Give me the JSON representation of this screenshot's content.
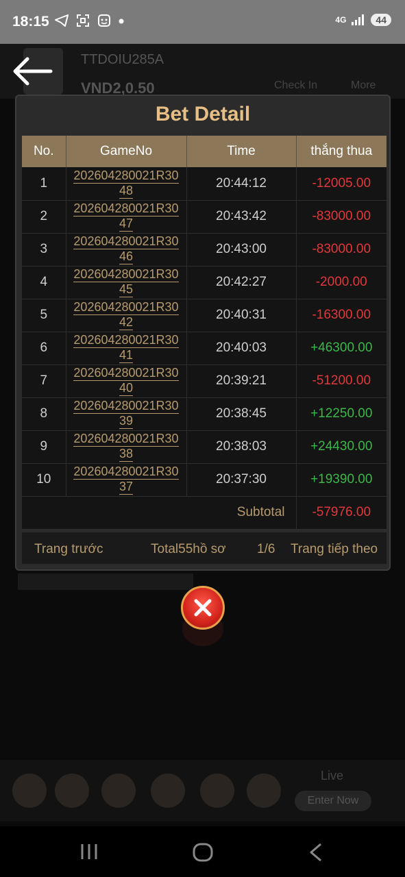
{
  "status_bar": {
    "time": "18:15",
    "network": "4G",
    "battery": "44",
    "icons": [
      "telegram-icon",
      "scan-icon",
      "bot-icon",
      "dot-icon",
      "signal-icon"
    ]
  },
  "background": {
    "username": "TTDOIU285A",
    "balance": "VND2,0.50",
    "menu_items": [
      "Check In",
      "More"
    ],
    "live_label": "Live",
    "enter_now_label": "Enter Now"
  },
  "modal": {
    "title": "Bet Detail",
    "columns": [
      "No.",
      "GameNo",
      "Time",
      "thắng thua"
    ],
    "rows": [
      {
        "no": "1",
        "game_line1": "202604280021R30",
        "game_line2": "48",
        "time": "20:44:12",
        "result": "-12005.00"
      },
      {
        "no": "2",
        "game_line1": "202604280021R30",
        "game_line2": "47",
        "time": "20:43:42",
        "result": "-83000.00"
      },
      {
        "no": "3",
        "game_line1": "202604280021R30",
        "game_line2": "46",
        "time": "20:43:00",
        "result": "-83000.00"
      },
      {
        "no": "4",
        "game_line1": "202604280021R30",
        "game_line2": "45",
        "time": "20:42:27",
        "result": "-2000.00"
      },
      {
        "no": "5",
        "game_line1": "202604280021R30",
        "game_line2": "42",
        "time": "20:40:31",
        "result": "-16300.00"
      },
      {
        "no": "6",
        "game_line1": "202604280021R30",
        "game_line2": "41",
        "time": "20:40:03",
        "result": "+46300.00"
      },
      {
        "no": "7",
        "game_line1": "202604280021R30",
        "game_line2": "40",
        "time": "20:39:21",
        "result": "-51200.00"
      },
      {
        "no": "8",
        "game_line1": "202604280021R30",
        "game_line2": "39",
        "time": "20:38:45",
        "result": "+12250.00"
      },
      {
        "no": "9",
        "game_line1": "202604280021R30",
        "game_line2": "38",
        "time": "20:38:03",
        "result": "+24430.00"
      },
      {
        "no": "10",
        "game_line1": "202604280021R30",
        "game_line2": "37",
        "time": "20:37:30",
        "result": "+19390.00"
      }
    ],
    "subtotal_label": "Subtotal",
    "subtotal_value": "-57976.00",
    "pager": {
      "prev": "Trang trước",
      "total": "Total55hồ sơ",
      "page": "1/6",
      "next": "Trang tiếp theo"
    }
  },
  "colors": {
    "title": "#e7bf85",
    "header_bg": "#8c7858",
    "negative": "#e0383c",
    "positive": "#3db74a",
    "link": "#b79b6e"
  }
}
